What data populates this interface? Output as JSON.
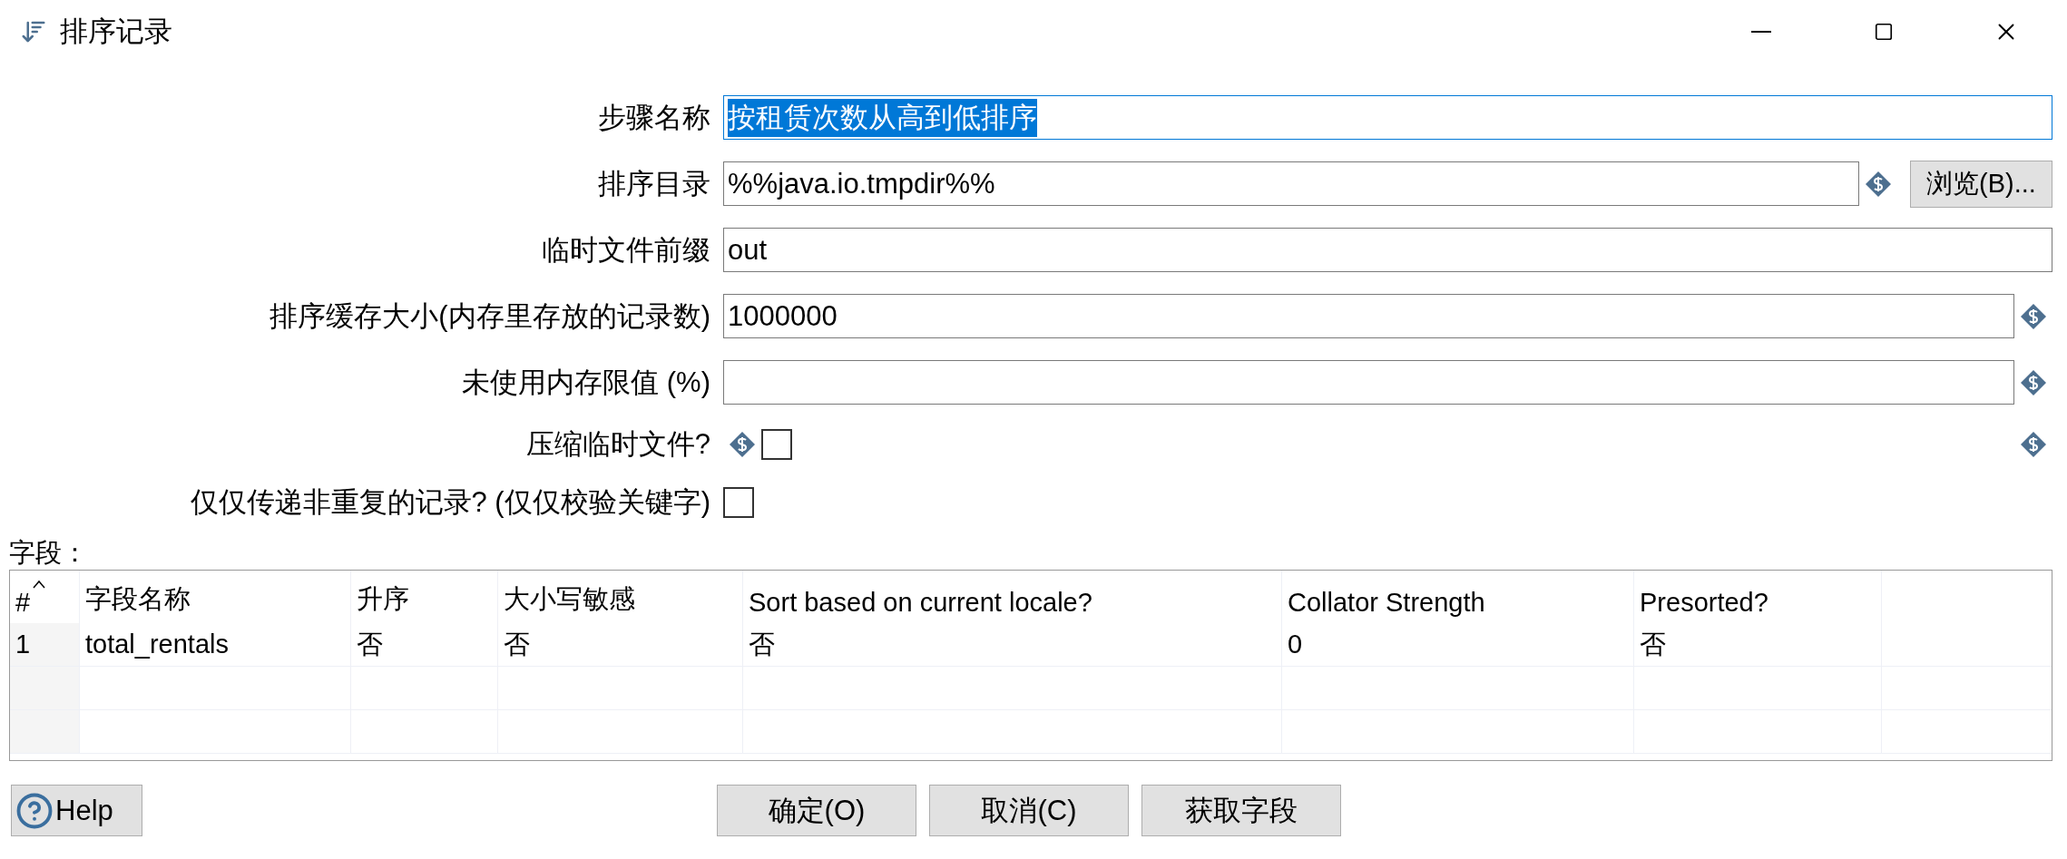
{
  "window": {
    "title": "排序记录"
  },
  "form": {
    "rows": [
      {
        "kind": "text",
        "label": "步骤名称",
        "value": "按租赁次数从高到低排序",
        "focused": true,
        "text_selected": true,
        "variable": false
      },
      {
        "kind": "text",
        "label": "排序目录",
        "value": "%%java.io.tmpdir%%",
        "focused": false,
        "text_selected": false,
        "variable": true,
        "button": "浏览(B)..."
      },
      {
        "kind": "text",
        "label": "临时文件前缀",
        "value": "out",
        "focused": false,
        "text_selected": false,
        "variable": false
      },
      {
        "kind": "text",
        "label": "排序缓存大小(内存里存放的记录数)",
        "value": "1000000",
        "focused": false,
        "text_selected": false,
        "variable": true
      },
      {
        "kind": "text",
        "label": "未使用内存限值 (%)",
        "focused": false,
        "variable": true
      },
      {
        "kind": "checkbox",
        "label": "压缩临时文件?",
        "checked": false,
        "variable": true,
        "variable_right": true
      },
      {
        "kind": "checkbox",
        "label": "仅仅传递非重复的记录? (仅仅校验关键字)",
        "checked": false,
        "variable": false,
        "variable_right": false
      }
    ]
  },
  "fields": {
    "label": "字段：",
    "columns": [
      {
        "label": "#",
        "sorted": true
      },
      {
        "label": "字段名称",
        "sorted": false
      },
      {
        "label": "升序",
        "sorted": false
      },
      {
        "label": "大小写敏感",
        "sorted": false
      },
      {
        "label": "Sort based on current locale?",
        "sorted": false
      },
      {
        "label": "Collator Strength",
        "sorted": false
      },
      {
        "label": "Presorted?",
        "sorted": false
      }
    ],
    "rows": [
      {
        "cells": [
          "1",
          "total_rentals",
          "否",
          "否",
          "否",
          "0",
          "否"
        ]
      }
    ]
  },
  "help": {
    "label": "Help"
  },
  "buttons": [
    "确定(O)",
    "取消(C)",
    "获取字段"
  ]
}
